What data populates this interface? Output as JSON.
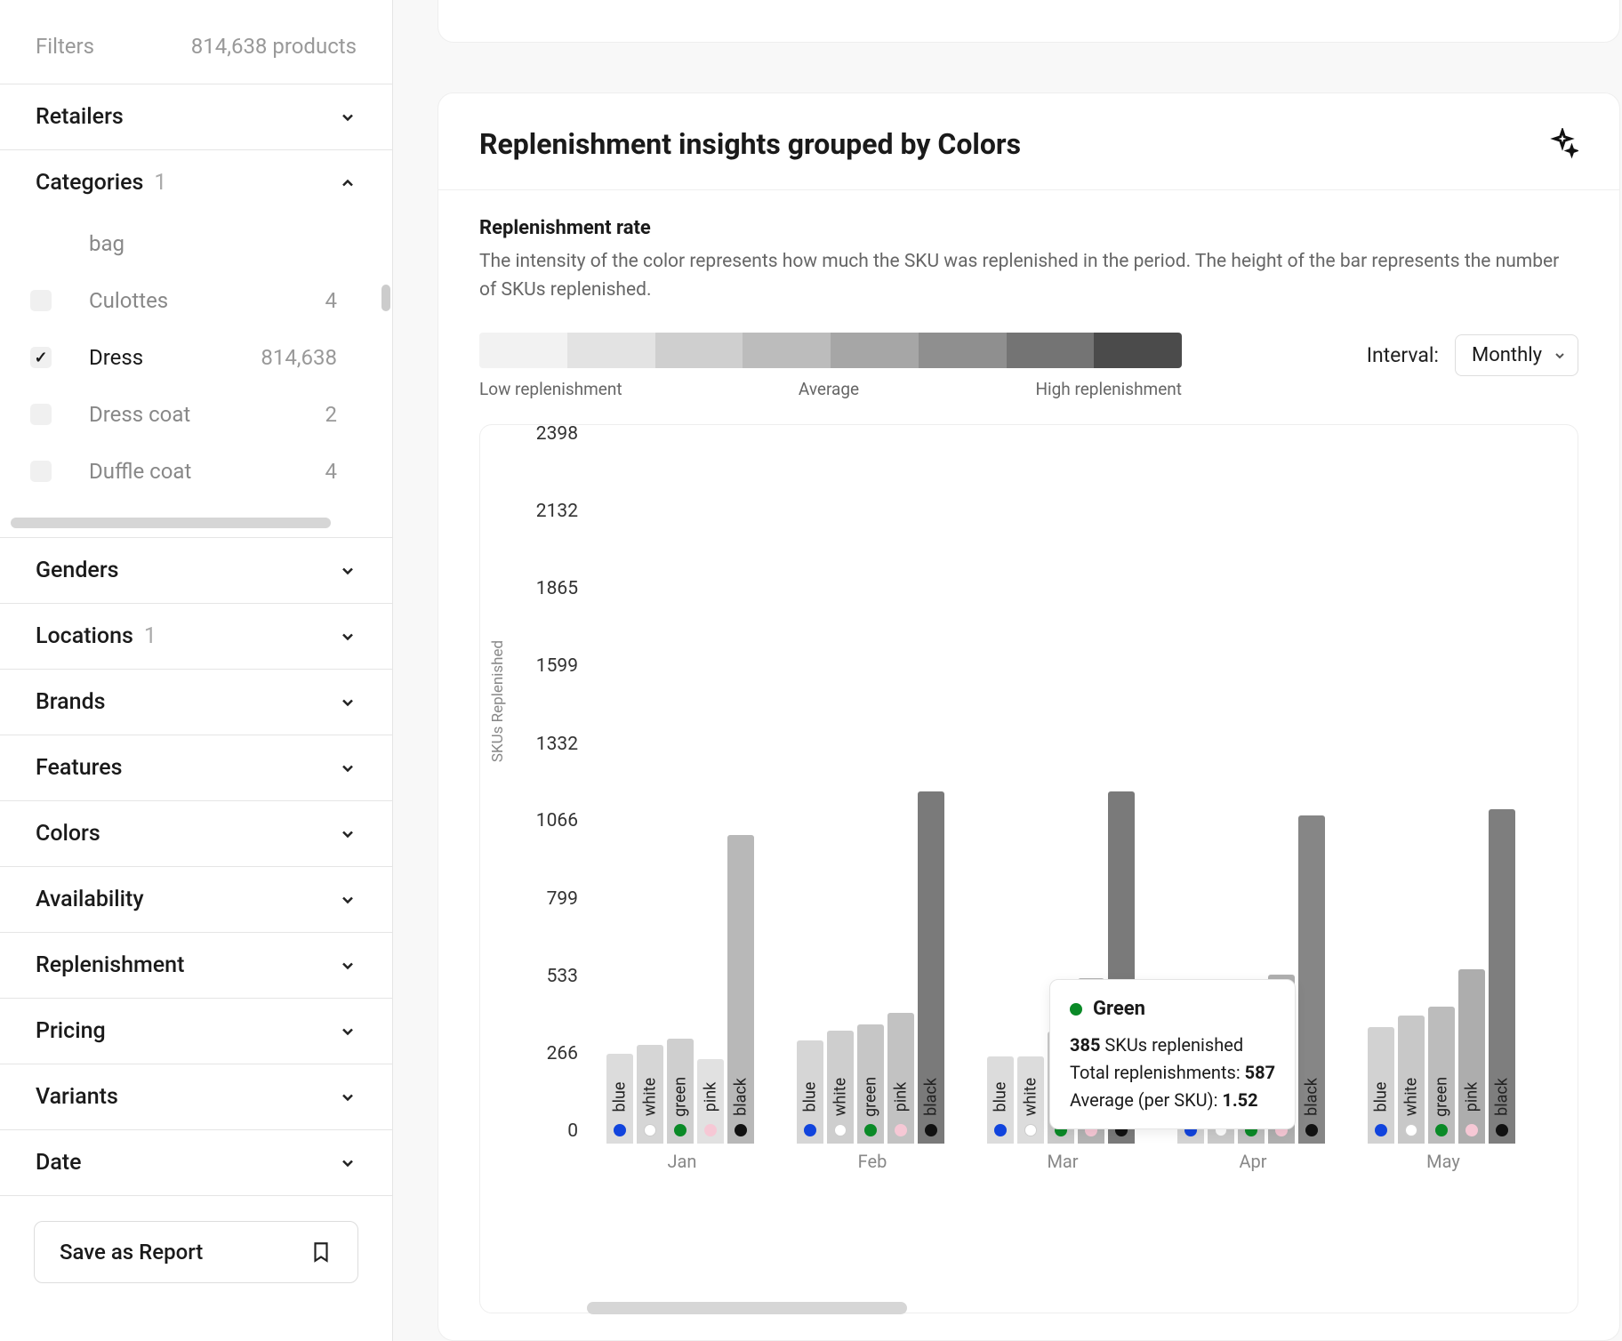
{
  "sidebar": {
    "filters_label": "Filters",
    "product_count": "814,638 products",
    "sections": {
      "retailers": "Retailers",
      "categories": "Categories",
      "categories_count": "1",
      "genders": "Genders",
      "locations": "Locations",
      "locations_count": "1",
      "brands": "Brands",
      "features": "Features",
      "colors": "Colors",
      "availability": "Availability",
      "replenishment": "Replenishment",
      "pricing": "Pricing",
      "variants": "Variants",
      "date": "Date"
    },
    "categories": [
      {
        "label": "bag",
        "count": "",
        "checked": false
      },
      {
        "label": "Culottes",
        "count": "4",
        "checked": false
      },
      {
        "label": "Dress",
        "count": "814,638",
        "checked": true
      },
      {
        "label": "Dress coat",
        "count": "2",
        "checked": false
      },
      {
        "label": "Duffle coat",
        "count": "4",
        "checked": false
      }
    ],
    "save_report": "Save as Report"
  },
  "card": {
    "title": "Replenishment insights grouped by Colors",
    "sub_title": "Replenishment rate",
    "sub_desc": "The intensity of the color represents how much the SKU was replenished in the period. The height of the bar represents the number of SKUs replenished.",
    "legend_low": "Low replenishment",
    "legend_avg": "Average",
    "legend_high": "High replenishment",
    "interval_label": "Interval:",
    "interval_value": "Monthly"
  },
  "gradient_colors": [
    "#f2f2f2",
    "#e3e3e3",
    "#cfcfcf",
    "#bcbcbc",
    "#a6a6a6",
    "#8f8f8f",
    "#747474",
    "#4b4b4b"
  ],
  "tooltip": {
    "title": "Green",
    "line1_val": "385",
    "line1_txt": " SKUs replenished",
    "line2_lbl": "Total replenishments: ",
    "line2_val": "587",
    "line3_lbl": "Average (per SKU): ",
    "line3_val": "1.52"
  },
  "chart_data": {
    "type": "bar",
    "title": "Replenishment insights grouped by Colors",
    "xlabel": "",
    "ylabel": "SKUs Replenished",
    "y_ticks": [
      0,
      266,
      533,
      799,
      1066,
      1332,
      1599,
      1865,
      2132,
      2398
    ],
    "ylim": [
      0,
      2398
    ],
    "categories": [
      "Jan",
      "Feb",
      "Mar",
      "Apr",
      "May"
    ],
    "bar_labels": [
      "blue",
      "white",
      "green",
      "pink",
      "black"
    ],
    "dot_colors": [
      "#1144dd",
      "#ffffff",
      "#0a8a27",
      "#f6c8d5",
      "#111111"
    ],
    "series": [
      {
        "name": "blue",
        "values": [
          310,
          355,
          300,
          370,
          400
        ],
        "fills": [
          "#dcdcdc",
          "#d6d6d6",
          "#dcdcdc",
          "#d4d4d4",
          "#d2d2d2"
        ]
      },
      {
        "name": "white",
        "values": [
          340,
          390,
          300,
          420,
          440
        ],
        "fills": [
          "#d6d6d6",
          "#cecece",
          "#dcdcdc",
          "#cacaca",
          "#c8c8c8"
        ]
      },
      {
        "name": "green",
        "values": [
          360,
          410,
          385,
          440,
          470
        ],
        "fills": [
          "#cfcfcf",
          "#c6c6c6",
          "#cacaca",
          "#c0c0c0",
          "#bcbcbc"
        ]
      },
      {
        "name": "pink",
        "values": [
          290,
          450,
          570,
          580,
          600
        ],
        "fills": [
          "#e1e1e1",
          "#c2c2c2",
          "#b4b4b4",
          "#b0b0b0",
          "#adadad"
        ]
      },
      {
        "name": "black",
        "values": [
          1060,
          1210,
          1210,
          1130,
          1150
        ],
        "fills": [
          "#b8b8b8",
          "#7a7a7a",
          "#7a7a7a",
          "#868686",
          "#7e7e7e"
        ]
      }
    ]
  }
}
